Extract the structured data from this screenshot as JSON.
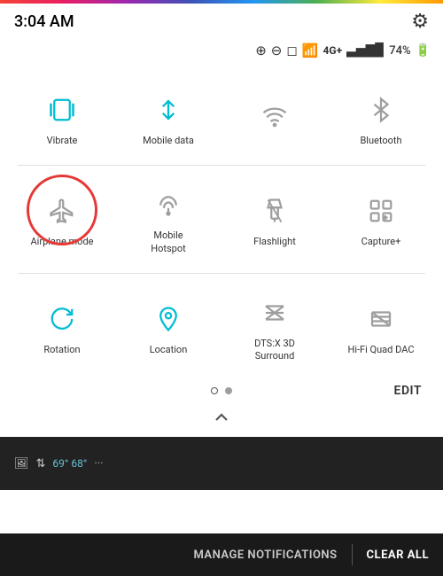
{
  "statusBar": {
    "time": "3:04 AM",
    "battery": "74%",
    "signal": "4G+"
  },
  "quickSettings": {
    "editLabel": "EDIT",
    "rows": [
      [
        {
          "id": "vibrate",
          "label": "Vibrate",
          "active": true,
          "icon": "vibrate"
        },
        {
          "id": "mobile-data",
          "label": "Mobile data",
          "active": true,
          "icon": "mobile-data"
        },
        {
          "id": "wifi",
          "label": "Wi-Fi",
          "active": false,
          "icon": "wifi"
        },
        {
          "id": "bluetooth",
          "label": "Bluetooth",
          "active": false,
          "icon": "bluetooth"
        }
      ],
      [
        {
          "id": "airplane-mode",
          "label": "Airplane mode",
          "active": false,
          "icon": "airplane",
          "circled": true
        },
        {
          "id": "mobile-hotspot",
          "label": "Mobile\nHotspot",
          "active": false,
          "icon": "hotspot"
        },
        {
          "id": "flashlight",
          "label": "Flashlight",
          "active": false,
          "icon": "flashlight"
        },
        {
          "id": "capture-plus",
          "label": "Capture+",
          "active": false,
          "icon": "capture-plus"
        }
      ],
      [
        {
          "id": "rotation",
          "label": "Rotation",
          "active": true,
          "icon": "rotation"
        },
        {
          "id": "location",
          "label": "Location",
          "active": true,
          "icon": "location"
        },
        {
          "id": "dts-3d",
          "label": "DTS:X 3D\nSurround",
          "active": false,
          "icon": "dts"
        },
        {
          "id": "hifi-quad",
          "label": "Hi-Fi Quad DAC",
          "active": false,
          "icon": "hifi"
        }
      ]
    ],
    "dots": [
      {
        "active": true
      },
      {
        "active": false
      }
    ]
  },
  "notification": {
    "manageLabel": "MANAGE NOTIFICATIONS",
    "clearAllLabel": "CLEAR ALL",
    "temp": "69° 68°"
  }
}
